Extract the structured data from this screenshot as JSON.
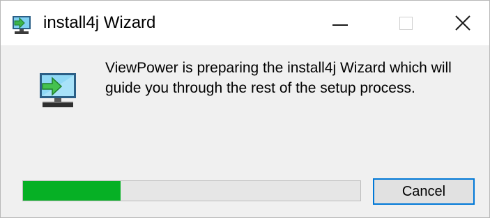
{
  "window": {
    "title": "install4j Wizard",
    "icon": "installer-monitor-icon"
  },
  "caption_buttons": {
    "minimize_icon": "minimize-icon",
    "maximize_icon": "maximize-icon",
    "close_icon": "close-icon"
  },
  "message": {
    "line1": "ViewPower is preparing the install4j Wizard which will",
    "line2": "guide you through the rest of the setup process."
  },
  "progress": {
    "fraction": 0.29,
    "color": "#06b025"
  },
  "buttons": {
    "cancel_label": "Cancel"
  },
  "colors": {
    "accent": "#0078d7",
    "background": "#f0f0f0"
  }
}
